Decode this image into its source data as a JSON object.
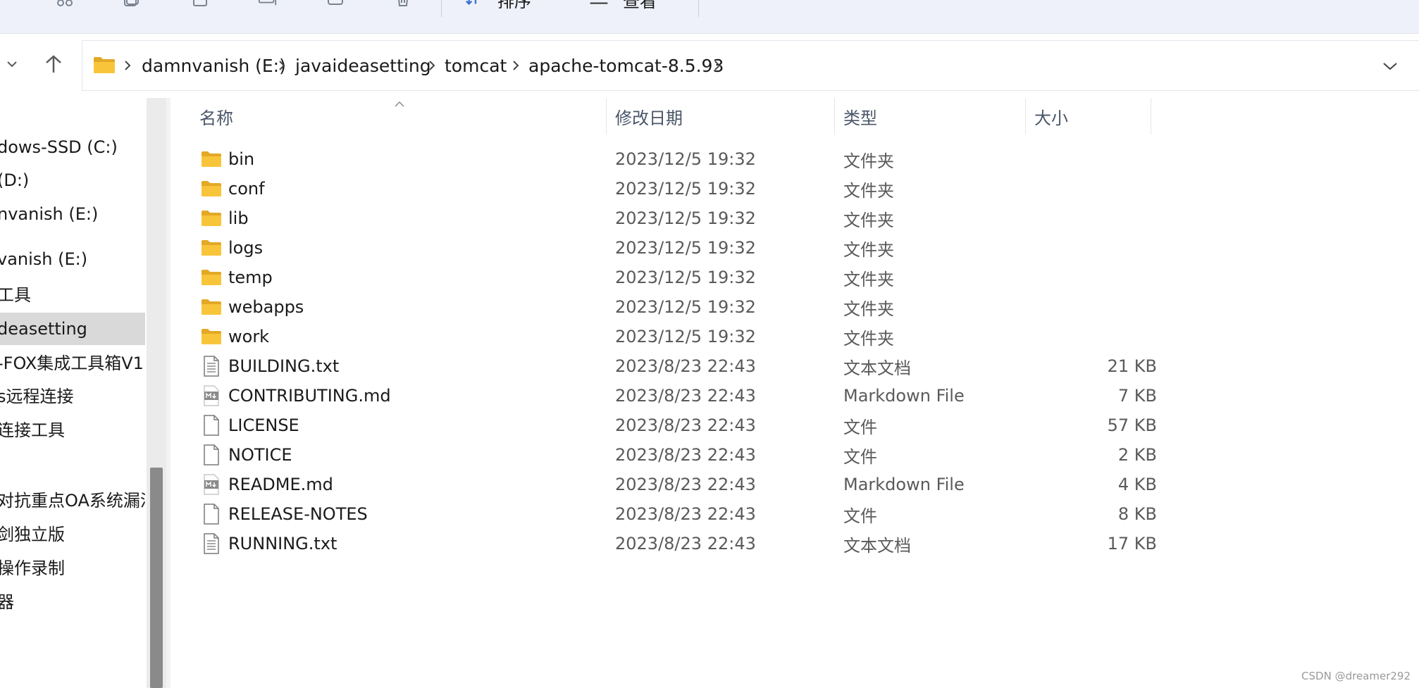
{
  "toolbar": {
    "sort_label": "排序",
    "view_label": "查看"
  },
  "breadcrumb": [
    {
      "label": "damnvanish (E:)"
    },
    {
      "label": "javaideasetting"
    },
    {
      "label": "tomcat"
    },
    {
      "label": "apache-tomcat-8.5.93"
    }
  ],
  "nav_pane": {
    "items": [
      {
        "label": "dows-SSD (C:)"
      },
      {
        "label": " (D:)"
      },
      {
        "label": "nvanish (E:)"
      },
      {
        "label": "vanish (E:)"
      },
      {
        "label": "工具"
      },
      {
        "label": "deasetting"
      },
      {
        "label": "-FOX集成工具箱V1"
      },
      {
        "label": "s远程连接"
      },
      {
        "label": "连接工具"
      },
      {
        "label": "对抗重点OA系统漏洞"
      },
      {
        "label": "剑独立版"
      },
      {
        "label": "操作录制"
      },
      {
        "label": "器"
      }
    ]
  },
  "columns": {
    "name": "名称",
    "date": "修改日期",
    "type": "类型",
    "size": "大小"
  },
  "files": [
    {
      "name": "bin",
      "date": "2023/12/5 19:32",
      "type": "文件夹",
      "size": "",
      "icon": "folder-icon"
    },
    {
      "name": "conf",
      "date": "2023/12/5 19:32",
      "type": "文件夹",
      "size": "",
      "icon": "folder-icon"
    },
    {
      "name": "lib",
      "date": "2023/12/5 19:32",
      "type": "文件夹",
      "size": "",
      "icon": "folder-icon"
    },
    {
      "name": "logs",
      "date": "2023/12/5 19:32",
      "type": "文件夹",
      "size": "",
      "icon": "folder-icon"
    },
    {
      "name": "temp",
      "date": "2023/12/5 19:32",
      "type": "文件夹",
      "size": "",
      "icon": "folder-icon"
    },
    {
      "name": "webapps",
      "date": "2023/12/5 19:32",
      "type": "文件夹",
      "size": "",
      "icon": "folder-icon"
    },
    {
      "name": "work",
      "date": "2023/12/5 19:32",
      "type": "文件夹",
      "size": "",
      "icon": "folder-icon"
    },
    {
      "name": "BUILDING.txt",
      "date": "2023/8/23 22:43",
      "type": "文本文档",
      "size": "21 KB",
      "icon": "text-file-icon"
    },
    {
      "name": "CONTRIBUTING.md",
      "date": "2023/8/23 22:43",
      "type": "Markdown File",
      "size": "7 KB",
      "icon": "markdown-file-icon"
    },
    {
      "name": "LICENSE",
      "date": "2023/8/23 22:43",
      "type": "文件",
      "size": "57 KB",
      "icon": "blank-file-icon"
    },
    {
      "name": "NOTICE",
      "date": "2023/8/23 22:43",
      "type": "文件",
      "size": "2 KB",
      "icon": "blank-file-icon"
    },
    {
      "name": "README.md",
      "date": "2023/8/23 22:43",
      "type": "Markdown File",
      "size": "4 KB",
      "icon": "markdown-file-icon"
    },
    {
      "name": "RELEASE-NOTES",
      "date": "2023/8/23 22:43",
      "type": "文件",
      "size": "8 KB",
      "icon": "blank-file-icon"
    },
    {
      "name": "RUNNING.txt",
      "date": "2023/8/23 22:43",
      "type": "文本文档",
      "size": "17 KB",
      "icon": "text-file-icon"
    }
  ],
  "selected_nav_item": "deasetting",
  "watermark": "CSDN @dreamer292",
  "colors": {
    "toolbar_bg": "#eef1f9",
    "selected_bg": "#d9d9d9",
    "folder_yellow": "#f8c53a",
    "folder_dark": "#e3a826"
  }
}
